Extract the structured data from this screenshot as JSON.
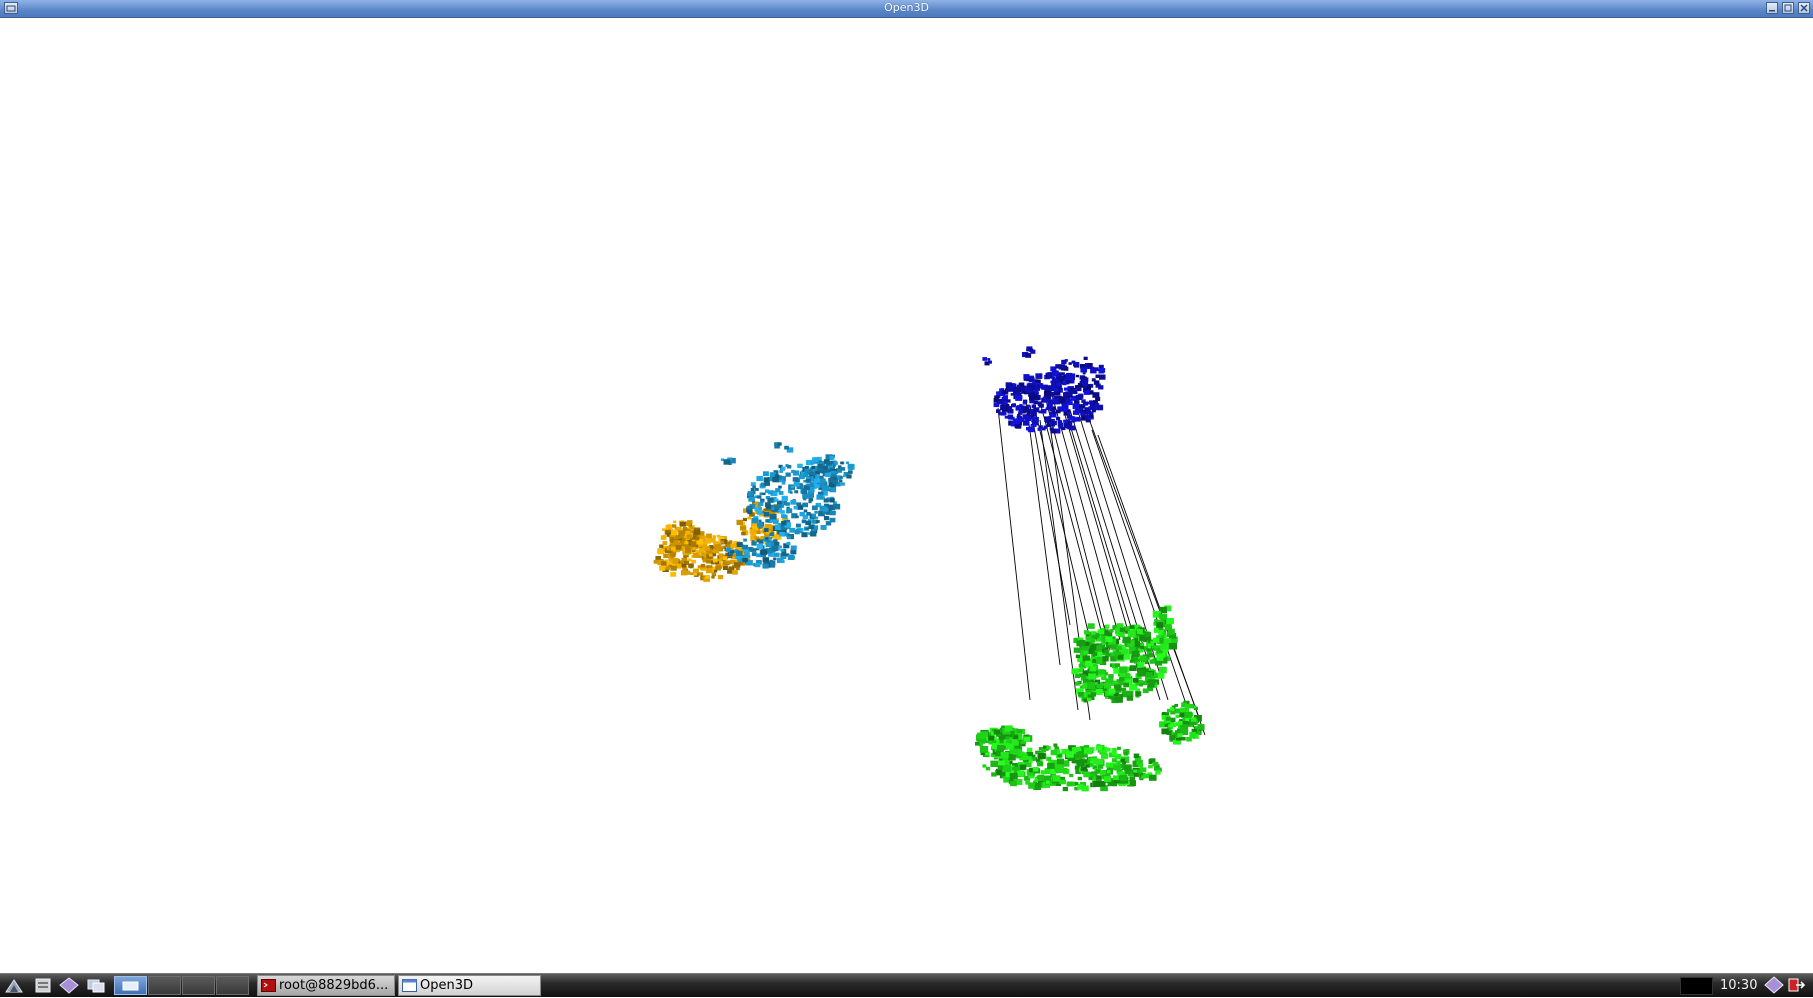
{
  "window": {
    "title": "Open3D"
  },
  "taskbar": {
    "launchers": [
      "start-menu-icon",
      "file-manager-icon",
      "app-icon",
      "windows-icon"
    ],
    "tasks": [
      {
        "label": "root@8829bd6...",
        "icon": "terminal-icon"
      },
      {
        "label": "Open3D",
        "icon": "window-icon"
      }
    ],
    "clock": "10:30"
  },
  "scene": {
    "clouds": [
      {
        "name": "yellow-cloud",
        "color": "#e8a800"
      },
      {
        "name": "cyan-cloud",
        "color": "#1e9ed6"
      },
      {
        "name": "blue-cloud",
        "color": "#1010c8"
      },
      {
        "name": "green-cloud",
        "color": "#22e21a"
      }
    ],
    "correspondence_line_color": "#000000"
  }
}
